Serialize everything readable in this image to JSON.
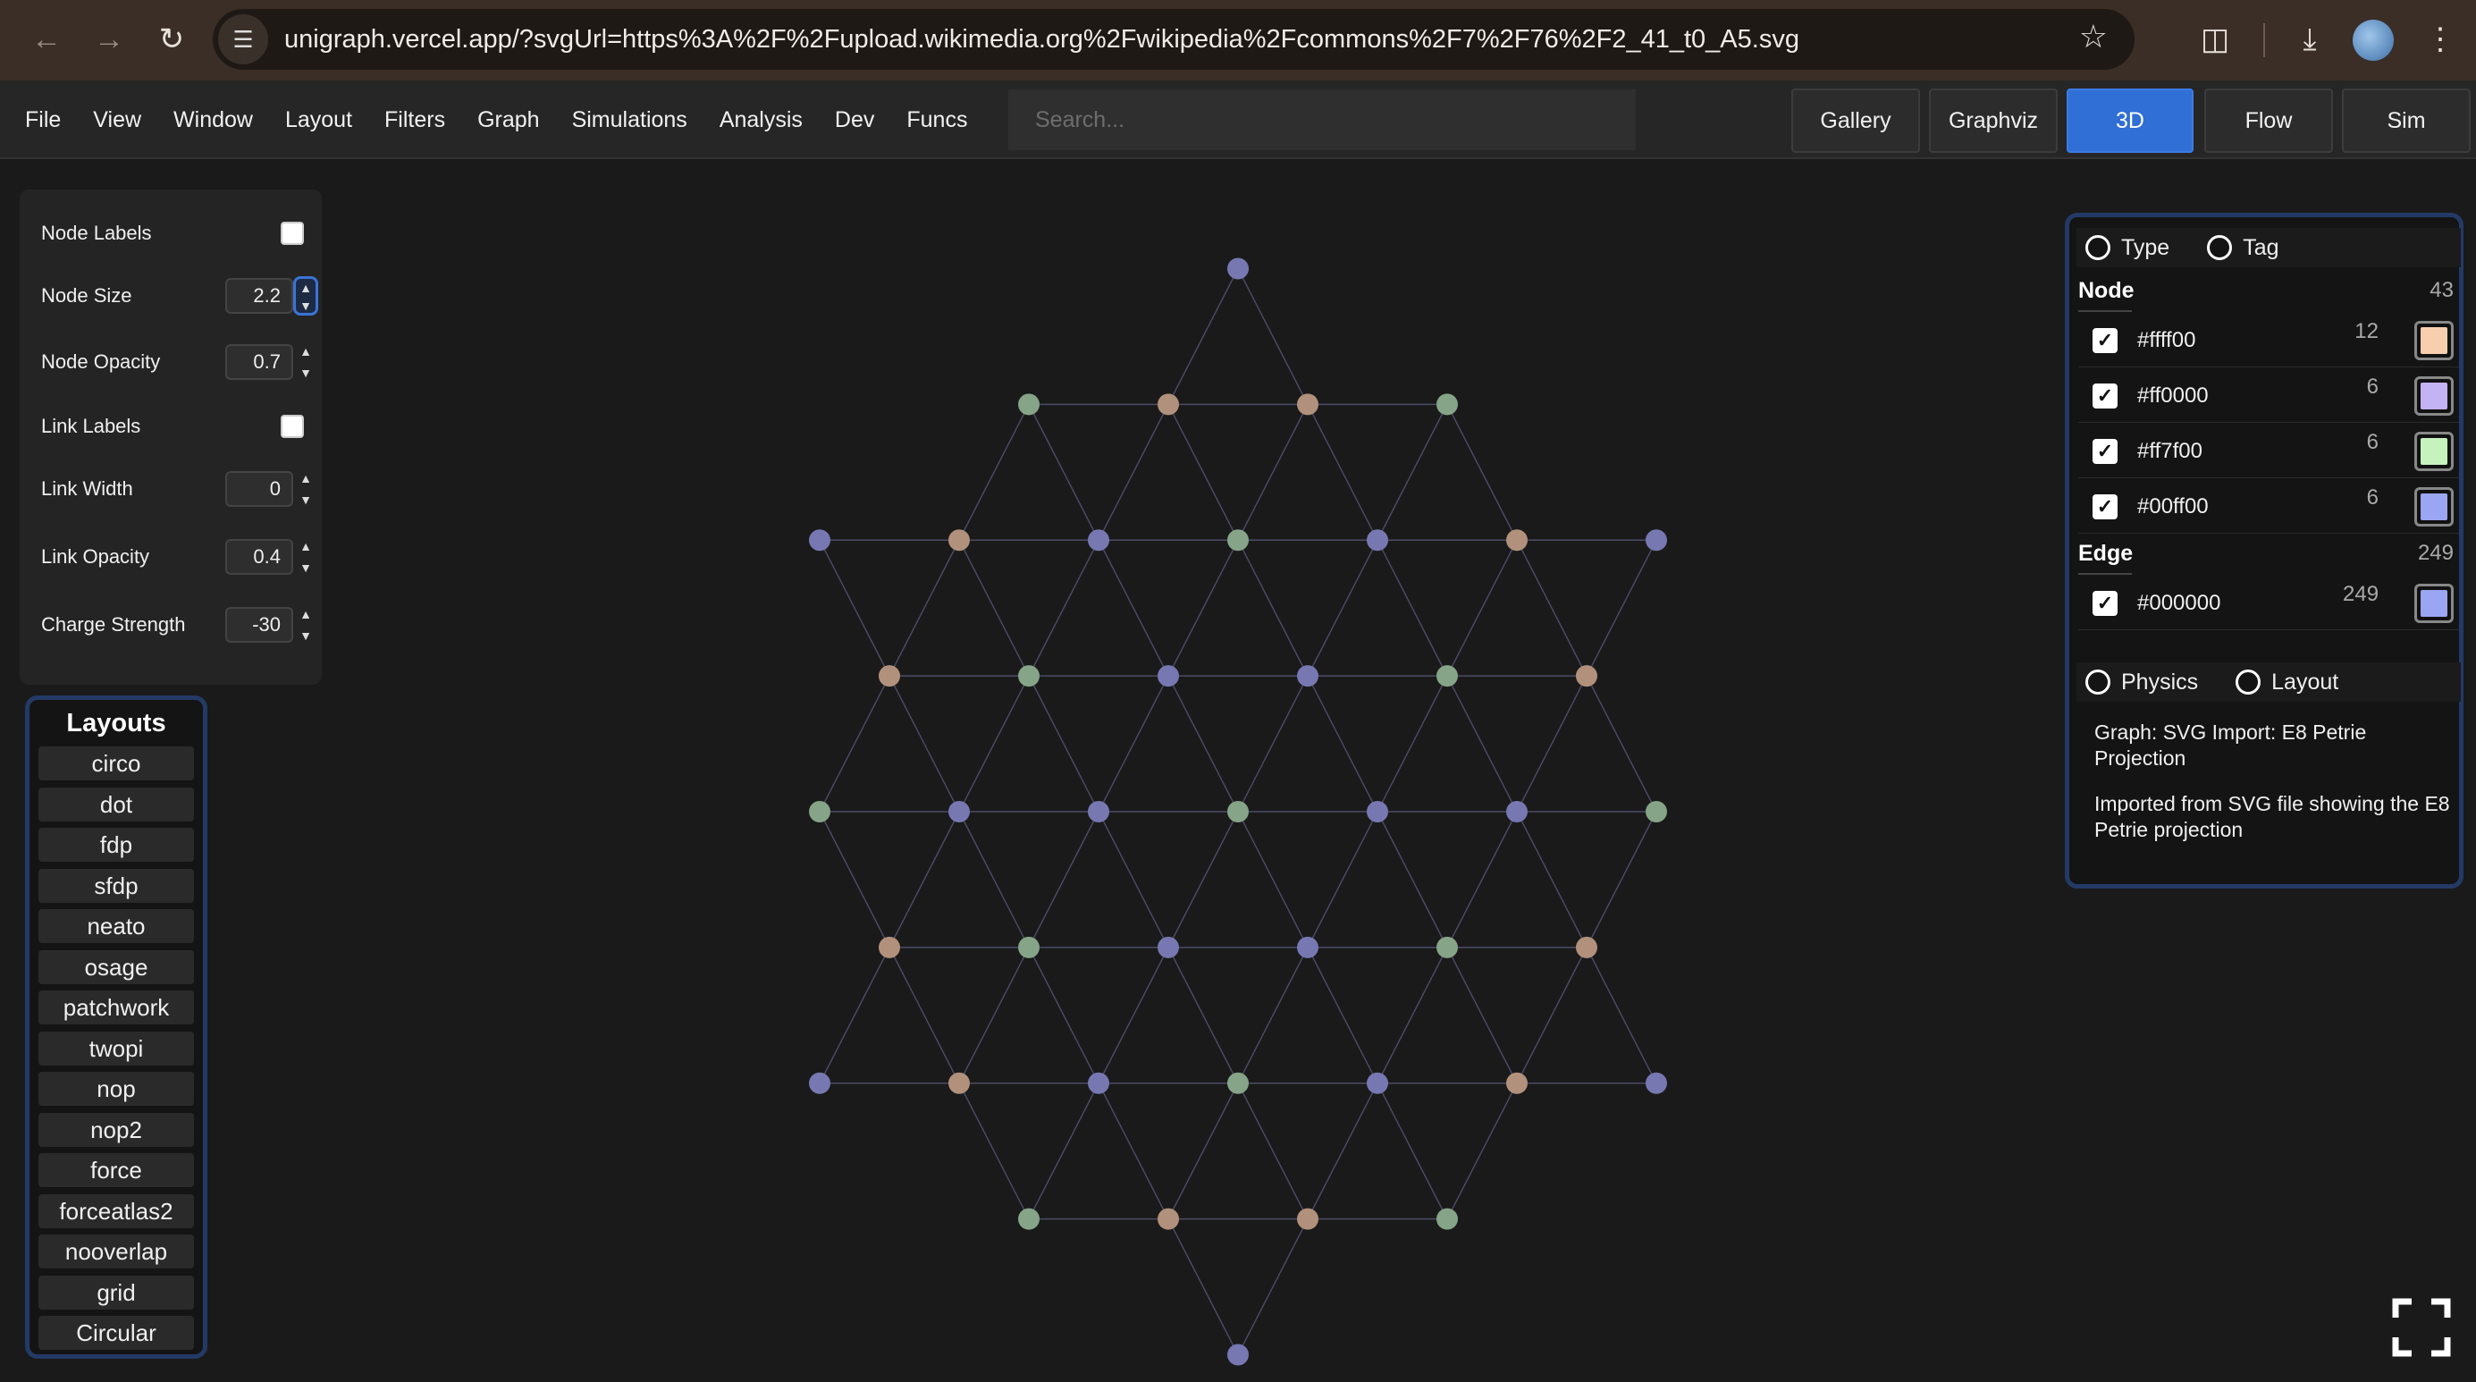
{
  "browser": {
    "url": "unigraph.vercel.app/?svgUrl=https%3A%2F%2Fupload.wikimedia.org%2Fwikipedia%2Fcommons%2F7%2F76%2F2_41_t0_A5.svg",
    "icons": [
      "back-icon",
      "forward-icon",
      "reload-icon",
      "site-settings-icon",
      "bookmark-star-icon",
      "extensions-icon",
      "download-icon",
      "profile-avatar",
      "more-menu-icon"
    ]
  },
  "menu": [
    "File",
    "View",
    "Window",
    "Layout",
    "Filters",
    "Graph",
    "Simulations",
    "Analysis",
    "Dev",
    "Funcs"
  ],
  "search": {
    "placeholder": "Search..."
  },
  "view_tabs": [
    {
      "label": "Gallery",
      "active": false
    },
    {
      "label": "Graphviz",
      "active": false
    },
    {
      "label": "3D",
      "active": true
    },
    {
      "label": "Flow",
      "active": false
    },
    {
      "label": "Sim",
      "active": false
    }
  ],
  "settings": [
    {
      "label": "Node Labels",
      "kind": "checkbox",
      "checked": false
    },
    {
      "label": "Node Size",
      "kind": "number",
      "value": "2.2"
    },
    {
      "label": "Node Opacity",
      "kind": "number",
      "value": "0.7"
    },
    {
      "label": "Link Labels",
      "kind": "checkbox",
      "checked": false
    },
    {
      "label": "Link Width",
      "kind": "number",
      "value": "0"
    },
    {
      "label": "Link Opacity",
      "kind": "number",
      "value": "0.4"
    },
    {
      "label": "Charge Strength",
      "kind": "number",
      "value": "-30"
    }
  ],
  "layouts": {
    "title": "Layouts",
    "items": [
      "circo",
      "dot",
      "fdp",
      "sfdp",
      "neato",
      "osage",
      "patchwork",
      "twopi",
      "nop",
      "nop2",
      "force",
      "forceatlas2",
      "nooverlap",
      "grid",
      "Circular"
    ]
  },
  "legend": {
    "mode_radios": [
      {
        "label": "Type",
        "selected": false
      },
      {
        "label": "Tag",
        "selected": false
      }
    ],
    "node_section": {
      "title": "Node",
      "count": "43"
    },
    "node_types": [
      {
        "label": "#ffff00",
        "count": "12",
        "checked": true,
        "color": "#f7cfae"
      },
      {
        "label": "#ff0000",
        "count": "6",
        "checked": true,
        "color": "#c3b3f5"
      },
      {
        "label": "#ff7f00",
        "count": "6",
        "checked": true,
        "color": "#c5f2bd"
      },
      {
        "label": "#00ff00",
        "count": "6",
        "checked": true,
        "color": "#9aa6f2"
      }
    ],
    "edge_section": {
      "title": "Edge",
      "count": "249"
    },
    "edge_types": [
      {
        "label": "#000000",
        "count": "249",
        "checked": true,
        "color": "#9aa6f2"
      }
    ],
    "sim_radios": [
      {
        "label": "Physics",
        "selected": false
      },
      {
        "label": "Layout",
        "selected": false
      }
    ],
    "graph_title": "Graph: SVG Import: E8 Petrie Projection",
    "graph_description": "Imported from SVG file showing the E8 Petrie projection"
  },
  "graph": {
    "node_colors": {
      "blue": "#7778b2",
      "brown": "#b1917b",
      "green": "#86a487"
    },
    "edge_color": "#7777aa"
  }
}
